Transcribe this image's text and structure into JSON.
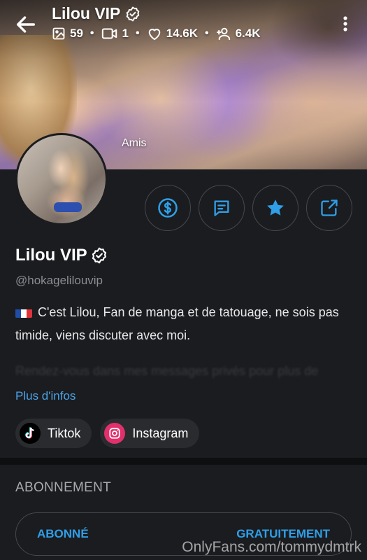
{
  "header": {
    "title": "Lilou VIP",
    "stats": [
      {
        "icon": "image-icon",
        "value": "59"
      },
      {
        "icon": "video-icon",
        "value": "1"
      },
      {
        "icon": "heart-icon",
        "value": "14.6K"
      },
      {
        "icon": "fans-icon",
        "value": "6.4K"
      }
    ],
    "cover_caption": "Amis"
  },
  "profile": {
    "name": "Lilou VIP",
    "handle": "@hokagelilouvip",
    "bio": "C'est Lilou, Fan de manga et de tatouage, ne sois pas timide, viens discuter avec moi.",
    "bio_faded": "Rendez-vous dans mes messages privés pour plus de contenu exclusif",
    "more_info": "Plus d'infos"
  },
  "actions": [
    {
      "name": "tip-button",
      "icon": "dollar-icon"
    },
    {
      "name": "message-button",
      "icon": "message-icon"
    },
    {
      "name": "favorite-button",
      "icon": "star-icon"
    },
    {
      "name": "share-button",
      "icon": "share-icon"
    }
  ],
  "socials": [
    {
      "label": "Tiktok",
      "icon": "tiktok-icon"
    },
    {
      "label": "Instagram",
      "icon": "instagram-icon"
    }
  ],
  "subscription": {
    "title": "ABONNEMENT",
    "left_label": "ABONNÉ",
    "right_label": "GRATUITEMENT"
  },
  "watermark": "OnlyFans.com/tommydmtrk",
  "colors": {
    "accent": "#2f9fe8",
    "link": "#4aa4e8",
    "background": "#1b1c1f",
    "instagram": "#e1306c"
  }
}
